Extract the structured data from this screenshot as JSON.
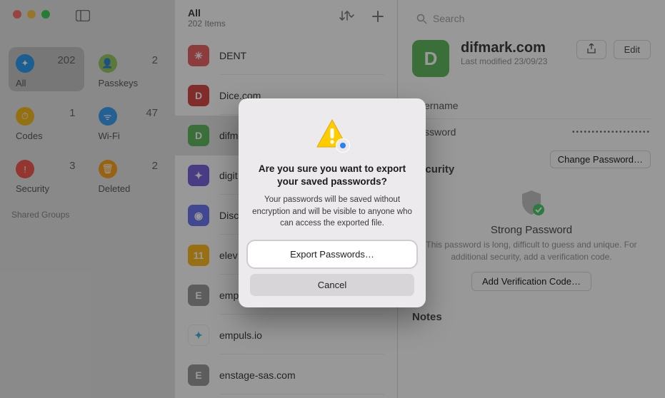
{
  "sidebar": {
    "cats": [
      {
        "label": "All",
        "count": "202"
      },
      {
        "label": "Passkeys",
        "count": "2"
      },
      {
        "label": "Codes",
        "count": "1"
      },
      {
        "label": "Wi-Fi",
        "count": "47"
      },
      {
        "label": "Security",
        "count": "3"
      },
      {
        "label": "Deleted",
        "count": "2"
      }
    ],
    "shared": "Shared Groups"
  },
  "list": {
    "title": "All",
    "subtitle": "202 Items",
    "items": [
      {
        "label": "DENT",
        "bg": "#e84f4f"
      },
      {
        "label": "Dice.com",
        "bg": "#d32f2f"
      },
      {
        "label": "difmark.com",
        "bg": "#4bb14b"
      },
      {
        "label": "digit",
        "bg": "#6a4fd8"
      },
      {
        "label": "Disc",
        "bg": "#5865f2"
      },
      {
        "label": "elev",
        "bg": "#ffb300"
      },
      {
        "label": "emp",
        "bg": "#8e8e8e"
      },
      {
        "label": "empuls.io",
        "bg": "#ffffff"
      },
      {
        "label": "enstage-sas.com",
        "bg": "#8e8e8e"
      }
    ]
  },
  "search": {
    "placeholder": "Search"
  },
  "detail": {
    "title": "difmark.com",
    "modified_label": "Last modified",
    "modified_date": "23/09/23",
    "share": "Share",
    "edit": "Edit",
    "username_label": "Username",
    "password_label": "Password",
    "password_mask": "••••••••••••••••••••",
    "change_pw": "Change Password…",
    "security_title": "Security",
    "strong": "Strong Password",
    "strong_desc": "This password is long, difficult to guess and unique. For additional security, add a verification code.",
    "add_vc": "Add Verification Code…",
    "notes": "Notes"
  },
  "modal": {
    "title": "Are you sure you want to export your saved passwords?",
    "body": "Your passwords will be saved without encryption and will be visible to anyone who can access the exported file.",
    "primary": "Export Passwords…",
    "secondary": "Cancel"
  }
}
